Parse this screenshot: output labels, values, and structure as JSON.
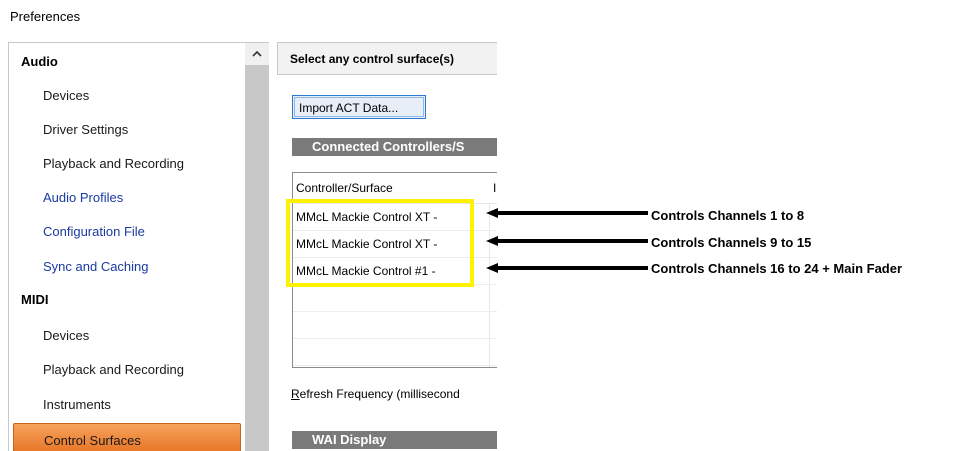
{
  "window": {
    "title": "Preferences"
  },
  "nav": {
    "items": [
      {
        "label": "Audio",
        "kind": "header"
      },
      {
        "label": "Devices",
        "kind": "item"
      },
      {
        "label": "Driver Settings",
        "kind": "item"
      },
      {
        "label": "Playback and Recording",
        "kind": "item"
      },
      {
        "label": "Audio Profiles",
        "kind": "link"
      },
      {
        "label": "Configuration File",
        "kind": "link"
      },
      {
        "label": "Sync and Caching",
        "kind": "link"
      },
      {
        "label": "MIDI",
        "kind": "header"
      },
      {
        "label": "Devices",
        "kind": "item"
      },
      {
        "label": "Playback and Recording",
        "kind": "item"
      },
      {
        "label": "Instruments",
        "kind": "item"
      },
      {
        "label": "Control Surfaces",
        "kind": "selected"
      }
    ],
    "scroll_up_icon": "chevron-up-icon"
  },
  "content": {
    "header": "Select any control surface(s)",
    "import_button": "Import ACT Data...",
    "section_connected": "Connected Controllers/S",
    "list": {
      "columns": [
        "Controller/Surface",
        "I"
      ],
      "rows": [
        "MMcL Mackie Control XT -",
        "MMcL Mackie Control XT -",
        "MMcL Mackie Control #1 -"
      ]
    },
    "refresh_label_underlined": "R",
    "refresh_label_rest": "efresh Frequency (millisecond",
    "section_wai": "WAI Display"
  },
  "annotations": {
    "highlight_color": "#fff200",
    "notes": [
      "Controls Channels 1 to 8",
      "Controls Channels 9 to 15",
      "Controls Channels 16 to 24 + Main Fader"
    ]
  },
  "colors": {
    "selected_start": "#f7a25c",
    "selected_end": "#e5701f",
    "section_bar": "#7a7a7a",
    "link": "#1a3aa0"
  }
}
